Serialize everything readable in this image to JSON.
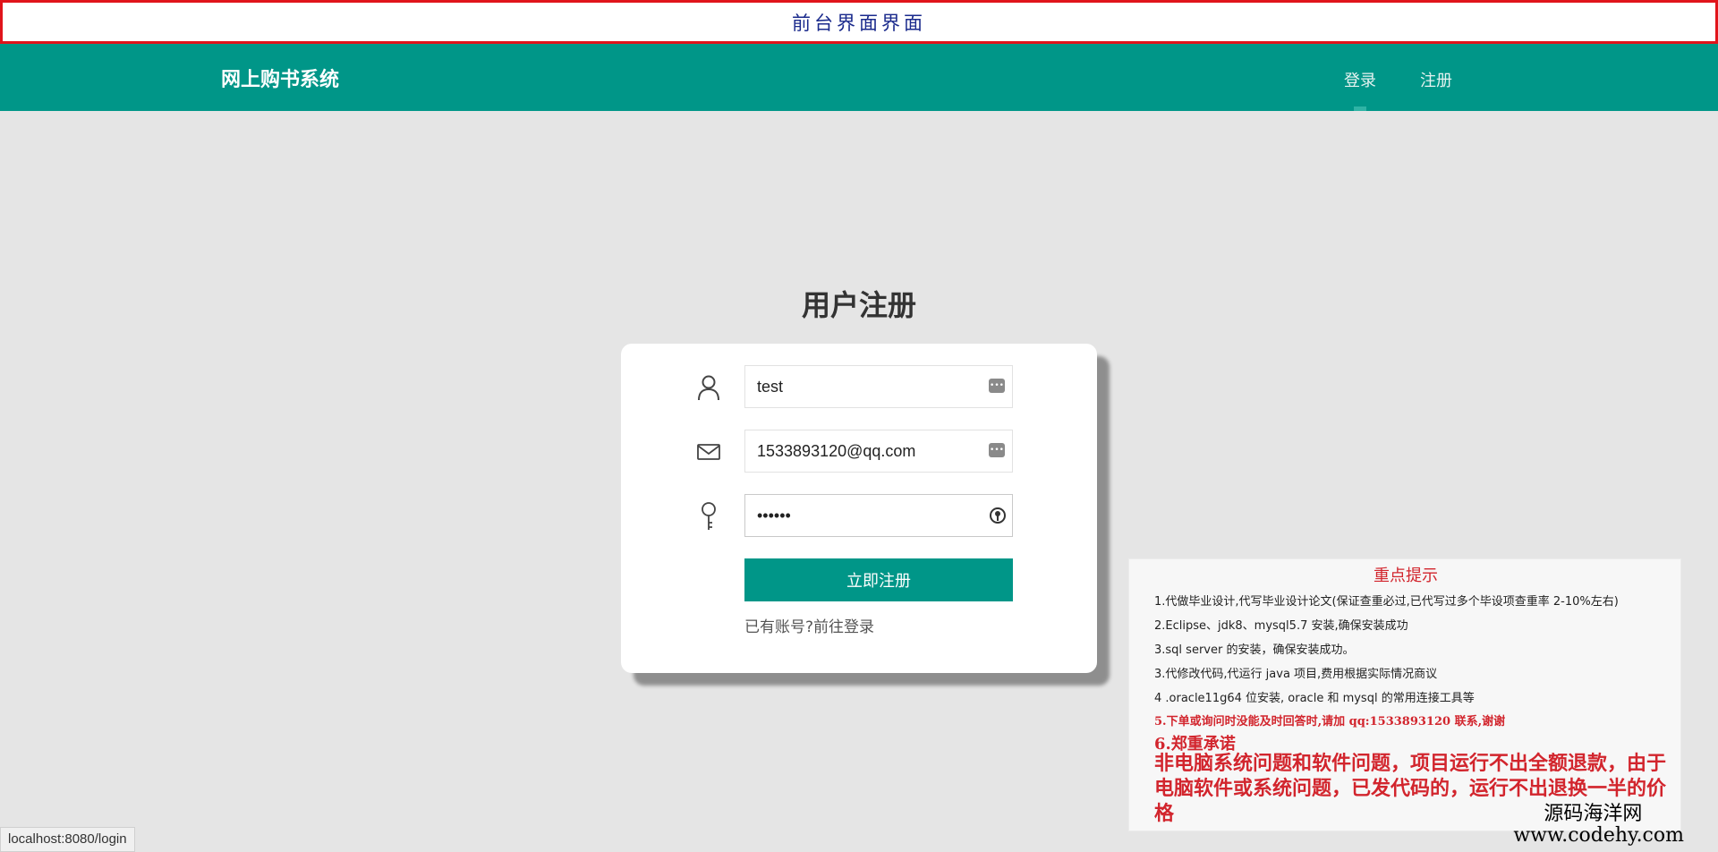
{
  "banner": {
    "text": "前台界面界面"
  },
  "nav": {
    "brand": "网上购书系统",
    "links": {
      "login": "登录",
      "register": "注册"
    },
    "accent": "#009688"
  },
  "page": {
    "title": "用户注册"
  },
  "form": {
    "username": {
      "value": "test",
      "icon": "user-icon"
    },
    "email": {
      "value": "1533893120@qq.com",
      "icon": "mail-icon"
    },
    "password": {
      "value": "••••••",
      "icon": "key-icon"
    },
    "submit_label": "立即注册",
    "hint_prefix": "已有账号?",
    "hint_link": "前往登录"
  },
  "notice": {
    "title": "重点提示",
    "lines": [
      "1.代做毕业设计,代写毕业设计论文(保证查重必过,已代写过多个毕设项查重率 2-10%左右)",
      "2.Eclipse、jdk8、mysql5.7 安装,确保安装成功",
      "3.sql server 的安装，确保安装成功。",
      "3.代修改代码,代运行 java 项目,费用根据实际情况商议",
      "4 .oracle11g64 位安装, oracle 和 mysql 的常用连接工具等",
      "5.下单或询问时没能及时回答时,请加 qq:1533893120 联系,谢谢"
    ],
    "heading6": "6.郑重承诺",
    "promise": "非电脑系统问题和软件问题，项目运行不出全额退款，由于电脑软件或系统问题，已发代码的，运行不出退换一半的价格"
  },
  "watermark": {
    "line1": "源码海洋网",
    "line2": "www.codehy.com"
  },
  "status_bar": {
    "url": "localhost:8080/login"
  }
}
